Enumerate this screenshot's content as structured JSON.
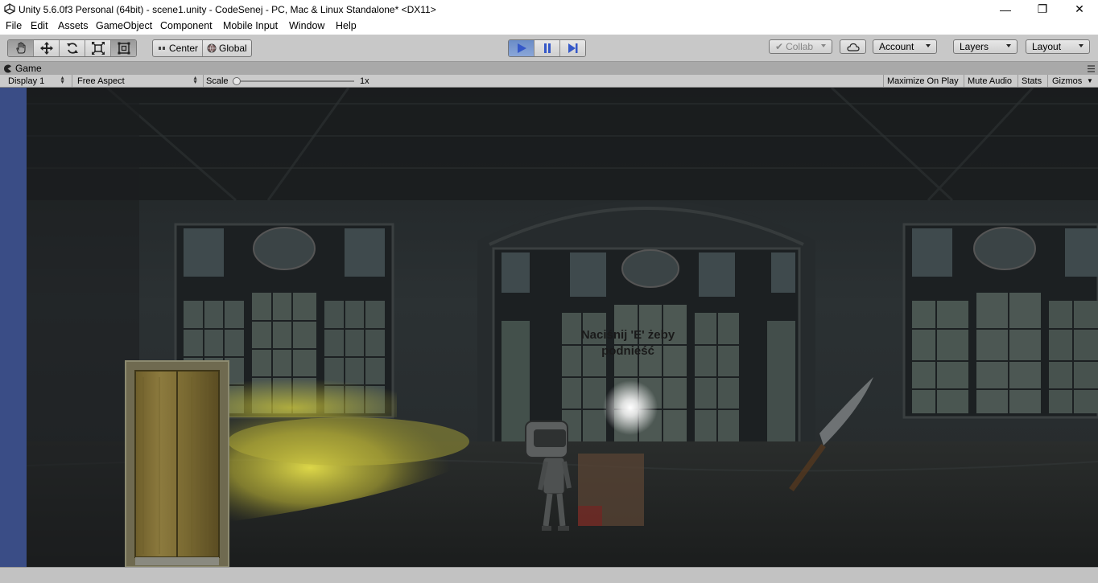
{
  "window": {
    "title": "Unity 5.6.0f3 Personal (64bit) - scene1.unity - CodeSenej - PC, Mac & Linux Standalone* <DX11>",
    "controls": {
      "minimize": "—",
      "restore": "❐",
      "close": "✕"
    }
  },
  "menu": [
    "File",
    "Edit",
    "Assets",
    "GameObject",
    "Component",
    "Mobile Input",
    "Window",
    "Help"
  ],
  "toolbar": {
    "transform_tools": [
      "hand-tool",
      "move-tool",
      "rotate-tool",
      "scale-tool",
      "rect-tool"
    ],
    "pivot_label": "Center",
    "space_label": "Global",
    "play_controls": [
      "play",
      "pause",
      "step"
    ],
    "collab_label": "Collab",
    "account_label": "Account",
    "layers_label": "Layers",
    "layout_label": "Layout"
  },
  "game_tab": {
    "label": "Game"
  },
  "game_bar": {
    "display": "Display 1",
    "aspect": "Free Aspect",
    "scale_label": "Scale",
    "scale_value": "1x",
    "maximize_on_play": "Maximize On Play",
    "mute_audio": "Mute Audio",
    "stats": "Stats",
    "gizmos": "Gizmos"
  },
  "scene": {
    "prompt_line1": "Naciśnij 'E' żeby",
    "prompt_line2": "podnieść"
  },
  "colors": {
    "play_active": "#6a8cc7",
    "left_strip": "#3a4d86",
    "flashlight": "#c8c23a"
  }
}
